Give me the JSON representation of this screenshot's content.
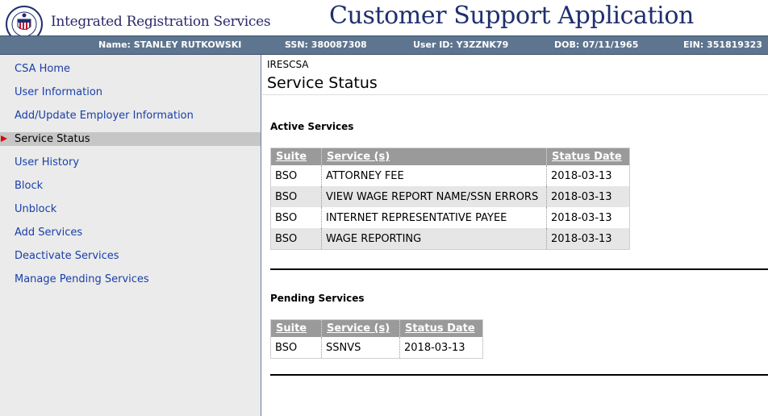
{
  "header": {
    "brand": "Integrated Registration Services",
    "app_title": "Customer Support Application"
  },
  "user_bar": {
    "name": "Name: STANLEY RUTKOWSKI",
    "ssn": "SSN: 380087308",
    "user_id": "User ID: Y3ZZNK79",
    "dob": "DOB: 07/11/1965",
    "ein": "EIN: 351819323"
  },
  "sidebar": {
    "items": [
      {
        "label": "CSA Home"
      },
      {
        "label": "User Information"
      },
      {
        "label": "Add/Update Employer Information"
      },
      {
        "label": "Service Status"
      },
      {
        "label": "User History"
      },
      {
        "label": "Block"
      },
      {
        "label": "Unblock"
      },
      {
        "label": "Add Services"
      },
      {
        "label": "Deactivate Services"
      },
      {
        "label": "Manage Pending Services"
      }
    ],
    "active_index": 3
  },
  "main": {
    "breadcrumb": "IRESCSA",
    "page_title": "Service Status",
    "active": {
      "heading": "Active Services",
      "columns": [
        "Suite",
        "Service (s)",
        "Status Date"
      ],
      "rows": [
        [
          "BSO",
          "ATTORNEY FEE",
          "2018-03-13"
        ],
        [
          "BSO",
          "VIEW WAGE REPORT NAME/SSN ERRORS",
          "2018-03-13"
        ],
        [
          "BSO",
          "INTERNET REPRESENTATIVE PAYEE",
          "2018-03-13"
        ],
        [
          "BSO",
          "WAGE REPORTING",
          "2018-03-13"
        ]
      ]
    },
    "pending": {
      "heading": "Pending Services",
      "columns": [
        "Suite",
        "Service (s)",
        "Status Date"
      ],
      "rows": [
        [
          "BSO",
          "SSNVS",
          "2018-03-13"
        ]
      ]
    }
  },
  "colors": {
    "infobar": "#5e7590",
    "link": "#1a3fa8",
    "active_arrow": "#e00000",
    "table_header": "#9a9a9a"
  }
}
